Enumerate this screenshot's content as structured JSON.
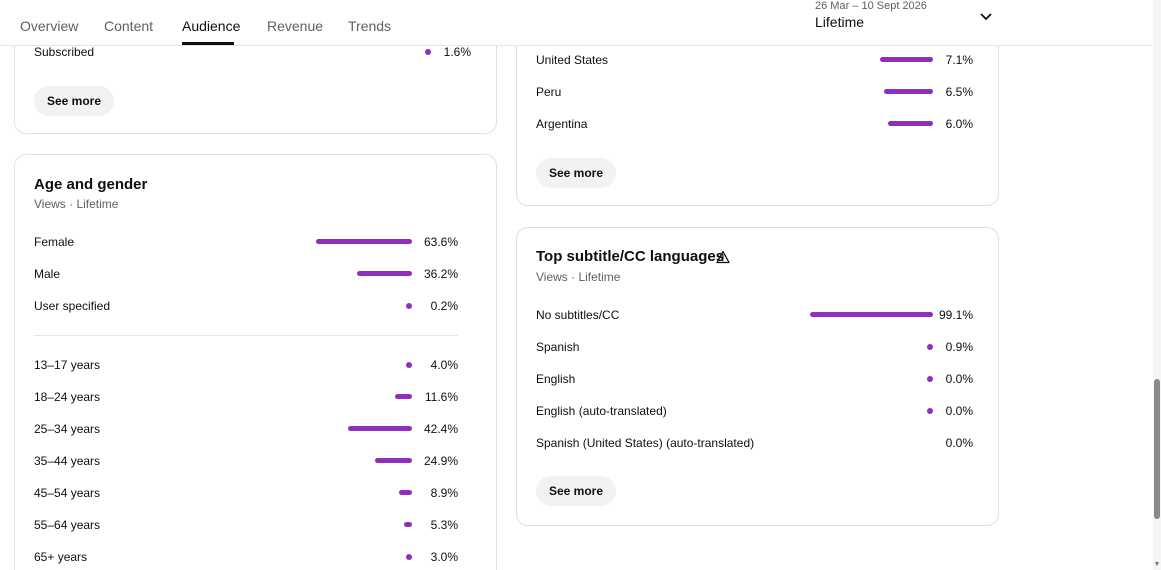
{
  "header": {
    "tabs": [
      "Overview",
      "Content",
      "Audience",
      "Revenue",
      "Trends"
    ],
    "active_tab": "Audience",
    "date_range": "26 Mar – 10 Sept 2026",
    "period": "Lifetime"
  },
  "subscription_card": {
    "rows": [
      {
        "label": "Subscribed",
        "value": "1.6%"
      }
    ],
    "see_more": "See more"
  },
  "geography_card": {
    "rows": [
      {
        "label": "United States",
        "value": "7.1%"
      },
      {
        "label": "Peru",
        "value": "6.5%"
      },
      {
        "label": "Argentina",
        "value": "6.0%"
      }
    ],
    "see_more": "See more"
  },
  "age_gender_card": {
    "title": "Age and gender",
    "subtitle": "Views · Lifetime",
    "gender_rows": [
      {
        "label": "Female",
        "value": "63.6%",
        "pct": 63.6
      },
      {
        "label": "Male",
        "value": "36.2%",
        "pct": 36.2
      },
      {
        "label": "User specified",
        "value": "0.2%",
        "pct": 0.2
      }
    ],
    "age_rows": [
      {
        "label": "13–17 years",
        "value": "4.0%",
        "pct": 4.0
      },
      {
        "label": "18–24 years",
        "value": "11.6%",
        "pct": 11.6
      },
      {
        "label": "25–34 years",
        "value": "42.4%",
        "pct": 42.4
      },
      {
        "label": "35–44 years",
        "value": "24.9%",
        "pct": 24.9
      },
      {
        "label": "45–54 years",
        "value": "8.9%",
        "pct": 8.9
      },
      {
        "label": "55–64 years",
        "value": "5.3%",
        "pct": 5.3
      },
      {
        "label": "65+ years",
        "value": "3.0%",
        "pct": 3.0
      }
    ]
  },
  "subtitle_card": {
    "title": "Top subtitle/CC languages",
    "subtitle": "Views · Lifetime",
    "rows": [
      {
        "label": "No subtitles/CC",
        "value": "99.1%"
      },
      {
        "label": "Spanish",
        "value": "0.9%"
      },
      {
        "label": "English",
        "value": "0.0%"
      },
      {
        "label": "English (auto-translated)",
        "value": "0.0%"
      },
      {
        "label": "Spanish (United States) (auto-translated)",
        "value": "0.0%"
      }
    ],
    "see_more": "See more"
  },
  "colors": {
    "bar": "#8e2fbd"
  }
}
